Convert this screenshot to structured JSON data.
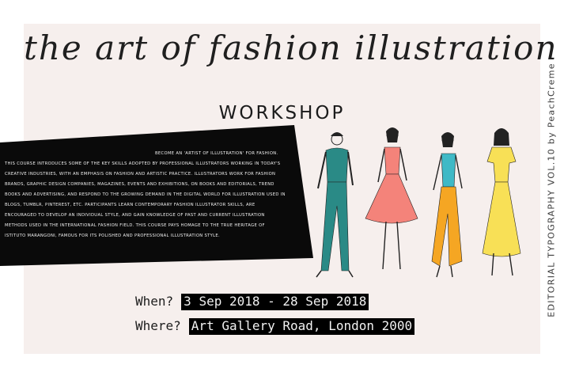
{
  "poster": {
    "title": "the art of fashion illustration",
    "subtitle": "WORKSHOP",
    "description": "Become an 'artist of illustration' for fashion. This course introduces some of the key skills adopted by professional illustrators working in today's creative industries, with an emphasis on fashion and artistic practice. Illustrators work for fashion brands, graphic design companies, magazines, events and exhibitions, on books and editorials, trend books and advertising, and respond to the growing demand in the digital world for illustration used in blogs, tumblr, pinterest, etc. Participants learn contemporary fashion illustrator skills, are encouraged to develop an individual style, and gain knowledge of past and current illustration methods used in the international fashion field. This course pays homage to the true heritage of Istituto Marangoni, famous for its polished and professional illustration style.",
    "when_label": "When?",
    "when_value": "3 Sep 2018 - 28 Sep 2018",
    "where_label": "Where?",
    "where_value": "Art Gallery Road, London 2000",
    "side_credit": "EDITORIAL TYPOGRAPHY VOL.10 by PeachCreme"
  },
  "colors": {
    "background": "#f6efed",
    "black_panel": "#0a0a0a",
    "figure_teal": "#2a8a86",
    "figure_coral": "#f4837a",
    "figure_orange": "#f5a623",
    "figure_yellow": "#f8e056",
    "figure_cyan": "#3fb9c6"
  }
}
